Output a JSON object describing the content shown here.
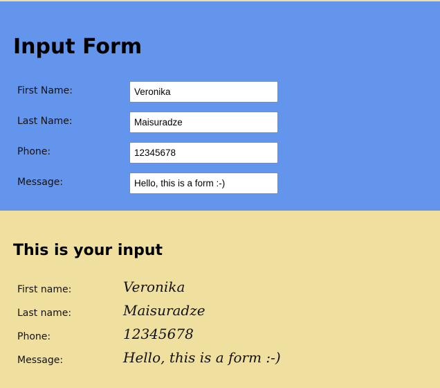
{
  "form": {
    "title": "Input Form",
    "fields": [
      {
        "label": "First Name:",
        "value": "Veronika"
      },
      {
        "label": "Last Name:",
        "value": "Maisuradze"
      },
      {
        "label": "Phone:",
        "value": "12345678"
      },
      {
        "label": "Message:",
        "value": "Hello, this is a form :-)"
      }
    ]
  },
  "output": {
    "title": "This is your input",
    "rows": [
      {
        "label": "First name:",
        "value": "Veronika"
      },
      {
        "label": "Last name:",
        "value": "Maisuradze"
      },
      {
        "label": "Phone:",
        "value": "12345678"
      },
      {
        "label": "Message:",
        "value": "Hello, this is a form :-)"
      }
    ]
  },
  "colors": {
    "form_background": "#6495ed",
    "output_background": "#f0e0a0"
  }
}
